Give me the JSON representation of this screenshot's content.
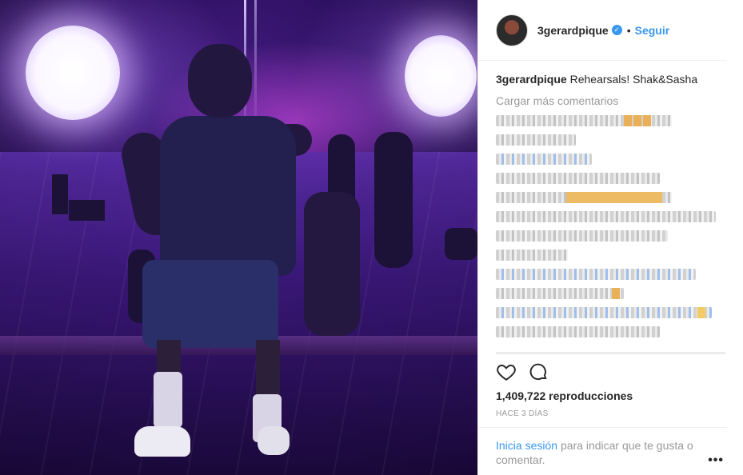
{
  "post": {
    "username": "3gerardpique",
    "follow_label": "Seguir",
    "separator": "•",
    "caption_user": "3gerardpique",
    "caption_text": "Rehearsals! Shak&Sasha",
    "load_more": "Cargar más comentarios",
    "views": "1,409,722 reproducciones",
    "timestamp": "HACE 3 DÍAS",
    "login_link": "Inicia sesión",
    "login_rest": "para indicar que te gusta o comentar.",
    "more_options": "•••"
  },
  "icons": [
    "verified-badge-icon",
    "heart-icon",
    "comment-icon",
    "more-options-icon"
  ],
  "colors": {
    "accent": "#3897f0",
    "muted": "#999999",
    "text": "#262626"
  }
}
